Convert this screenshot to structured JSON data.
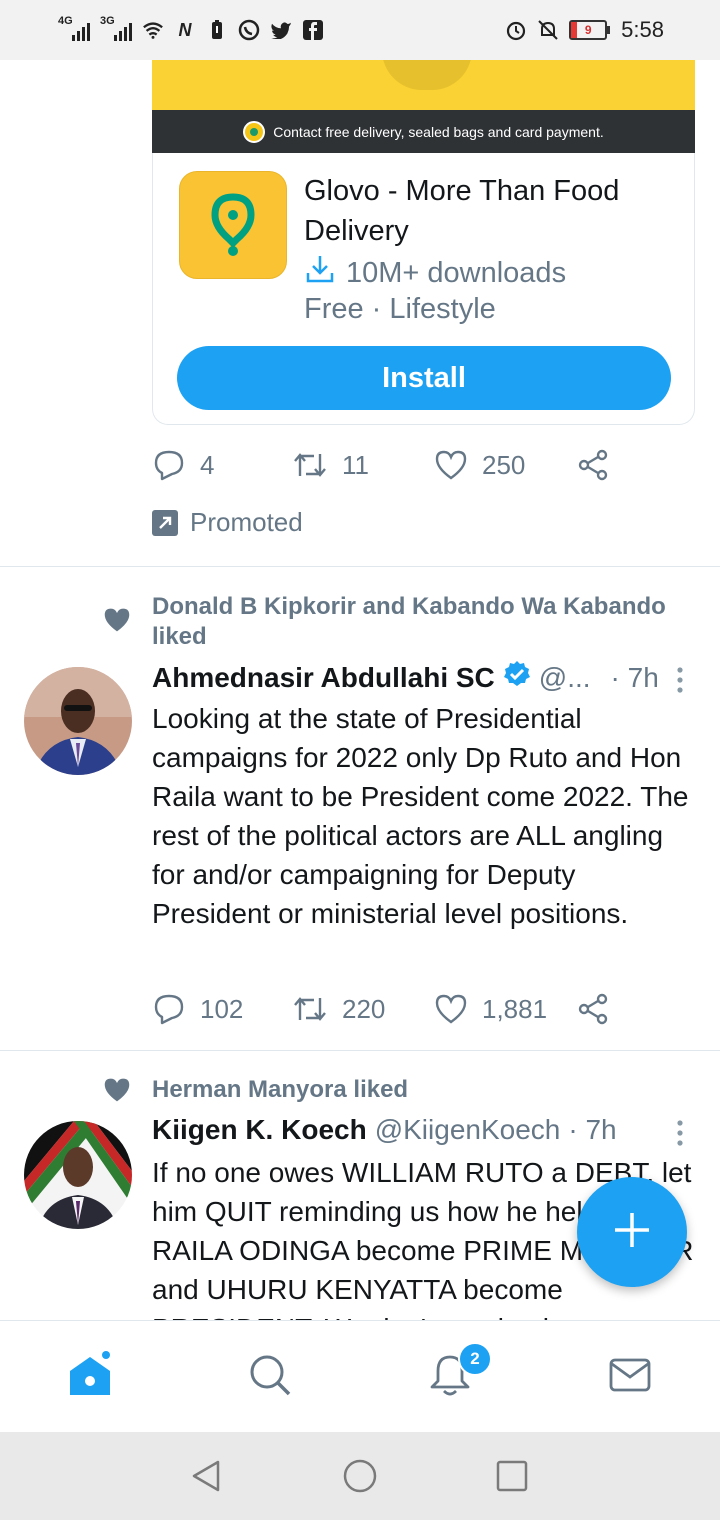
{
  "status_bar": {
    "network1": "4G",
    "network2": "3G",
    "battery": "9",
    "time": "5:58",
    "icons": [
      "signal-icon",
      "wifi-icon",
      "nfc-icon",
      "battery-saver-icon",
      "whatsapp-icon",
      "twitter-icon",
      "facebook-icon",
      "alarm-icon",
      "mute-icon"
    ]
  },
  "ad": {
    "strip_text": "Contact free delivery, sealed bags and card payment.",
    "app_title": "Glovo - More Than Food Delivery",
    "downloads": "10M+ downloads",
    "meta": "Free · Lifestyle",
    "install_label": "Install",
    "actions": {
      "replies": "4",
      "retweets": "11",
      "likes": "250"
    },
    "promoted_label": "Promoted"
  },
  "tweets": [
    {
      "context": "Donald B Kipkorir and Kabando Wa Kabando liked",
      "name": "Ahmednasir Abdullahi SC",
      "handle": "@...",
      "time": "· 7h",
      "text": "Looking at the state of Presidential campaigns for 2022 only Dp Ruto and Hon Raila want to be President come 2022. The rest of the political actors are ALL angling for and/or campaigning for Deputy President or ministerial level positions.",
      "replies": "102",
      "retweets": "220",
      "likes": "1,881"
    },
    {
      "context": "Herman Manyora liked",
      "name": "Kiigen K. Koech",
      "handle": "@KiigenKoech",
      "time": "· 7h",
      "text": "If no one owes WILLIAM RUTO a DEBT, let him QUIT reminding us how he helped RAILA ODINGA become PRIME MINISTER and UHURU KENYATTA become PRESIDENT. We don't need to be reminded."
    }
  ],
  "bottom_nav": {
    "notifications_badge": "2",
    "items": [
      "home-icon",
      "search-icon",
      "notifications-icon",
      "messages-icon"
    ]
  },
  "colors": {
    "accent": "#1da1f2",
    "muted": "#657786",
    "text": "#14171a",
    "glovo_yellow": "#f9c333",
    "glovo_green": "#00a082"
  }
}
